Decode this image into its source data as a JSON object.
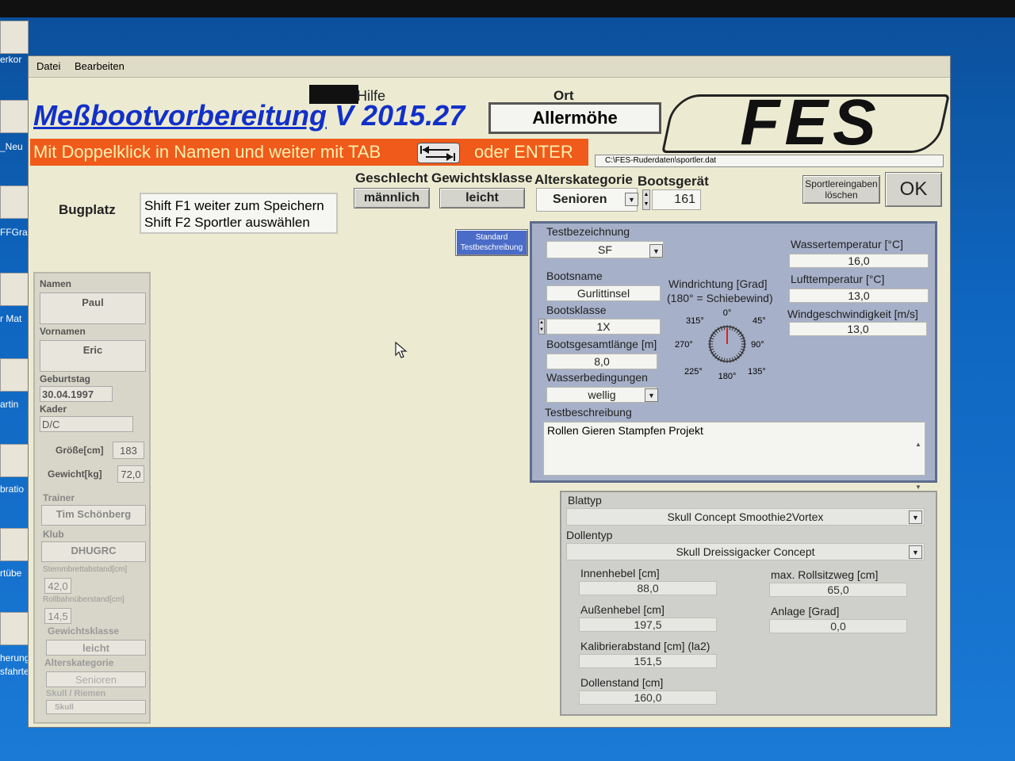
{
  "desktop": {
    "icon_labels": [
      "erkor",
      "_Neu",
      "FFGra",
      "r Mat",
      "artin",
      "bratio",
      "rtübe",
      "herung",
      "sfahrte"
    ]
  },
  "menu": {
    "items": [
      "Datei",
      "Bearbeiten"
    ]
  },
  "header": {
    "help_label": "Hilfe",
    "title_underlined": "Meßbootvorbereitung",
    "title_version": "V 2015.27",
    "ort_label": "Ort",
    "ort_value": "Allermöhe",
    "logo_text": "FES",
    "banner_text_1": "Mit Doppelklick in Namen und weiter mit TAB",
    "banner_text_2": "oder ENTER",
    "file_path": "C:\\FES-Ruderdaten\\sportler.dat"
  },
  "category": {
    "geschlecht_label": "Geschlecht",
    "gewichtsklasse_label": "Gewichtsklasse",
    "alterskategorie_label": "Alterskategorie",
    "bootsgeraet_label": "Bootsgerät",
    "geschlecht_value": "männlich",
    "gewichtsklasse_value": "leicht",
    "alterskategorie_value": "Senioren",
    "bootsgeraet_value": "161"
  },
  "actions": {
    "clear_label_1": "Sportlereingaben",
    "clear_label_2": "löschen",
    "ok_label": "OK",
    "standard_label_1": "Standard",
    "standard_label_2": "Testbeschreibung"
  },
  "position": {
    "label": "Bugplatz",
    "hint_1": "Shift F1 weiter zum Speichern",
    "hint_2": "Shift F2 Sportler auswählen"
  },
  "athlete": {
    "namen_label": "Namen",
    "namen": "Paul",
    "vornamen_label": "Vornamen",
    "vornamen": "Eric",
    "geburtstag_label": "Geburtstag",
    "geburtstag": "30.04.1997",
    "kader_label": "Kader",
    "kader": "D/C",
    "groesse_label": "Größe[cm]",
    "groesse": "183",
    "gewicht_label": "Gewicht[kg]",
    "gewicht": "72,0",
    "trainer_label": "Trainer",
    "trainer": "Tim Schönberg",
    "klub_label": "Klub",
    "klub": "DHUGRC",
    "stemmbrett_label": "Stemmbrettabstand[cm]",
    "stemmbrett": "42,0",
    "rollbahn_label": "Rollbahnüberstand[cm]",
    "rollbahn": "14,5",
    "gewichtsklasse_label": "Gewichtsklasse",
    "gewichtsklasse": "leicht",
    "alterskategorie_label": "Alterskategorie",
    "alterskategorie": "Senioren",
    "skull_label": "Skull / Riemen",
    "skull": "Skull"
  },
  "test": {
    "testbezeichnung_label": "Testbezeichnung",
    "testbezeichnung": "SF",
    "bootsname_label": "Bootsname",
    "bootsname": "Gurlittinsel",
    "bootsklasse_label": "Bootsklasse",
    "bootsklasse": "1X",
    "bootslaenge_label": "Bootsgesamtlänge [m]",
    "bootslaenge": "8,0",
    "wasserbed_label": "Wasserbedingungen",
    "wasserbed": "wellig",
    "testbeschreibung_label": "Testbeschreibung",
    "testbeschreibung": "Rollen Gieren Stampfen Projekt",
    "windrichtung_label_1": "Windrichtung [Grad]",
    "windrichtung_label_2": "(180° = Schiebewind)",
    "compass": {
      "n": "0°",
      "ne": "45°",
      "e": "90°",
      "se": "135°",
      "s": "180°",
      "sw": "225°",
      "w": "270°",
      "nw": "315°"
    },
    "wind_direction_deg": 0,
    "wassertemp_label": "Wassertemperatur [°C]",
    "wassertemp": "16,0",
    "lufttemp_label": "Lufttemperatur [°C]",
    "lufttemp": "13,0",
    "windgeschw_label": "Windgeschwindigkeit [m/s]",
    "windgeschw": "13,0"
  },
  "rigging": {
    "blattyp_label": "Blattyp",
    "blattyp": "Skull Concept Smoothie2Vortex",
    "dollentyp_label": "Dollentyp",
    "dollentyp": "Skull Dreissigacker Concept",
    "innenhebel_label": "Innenhebel [cm]",
    "innenhebel": "88,0",
    "aussenhebel_label": "Außenhebel [cm]",
    "aussenhebel": "197,5",
    "kalibrier_label": "Kalibrierabstand [cm] (la2)",
    "kalibrier": "151,5",
    "dollenstand_label": "Dollenstand [cm]",
    "dollenstand": "160,0",
    "rollsitz_label": "max. Rollsitzweg [cm]",
    "rollsitz": "65,0",
    "anlage_label": "Anlage [Grad]",
    "anlage": "0,0"
  },
  "colors": {
    "title": "#1230c8",
    "banner": "#f05a1a",
    "panel": "#a6b0c8"
  }
}
